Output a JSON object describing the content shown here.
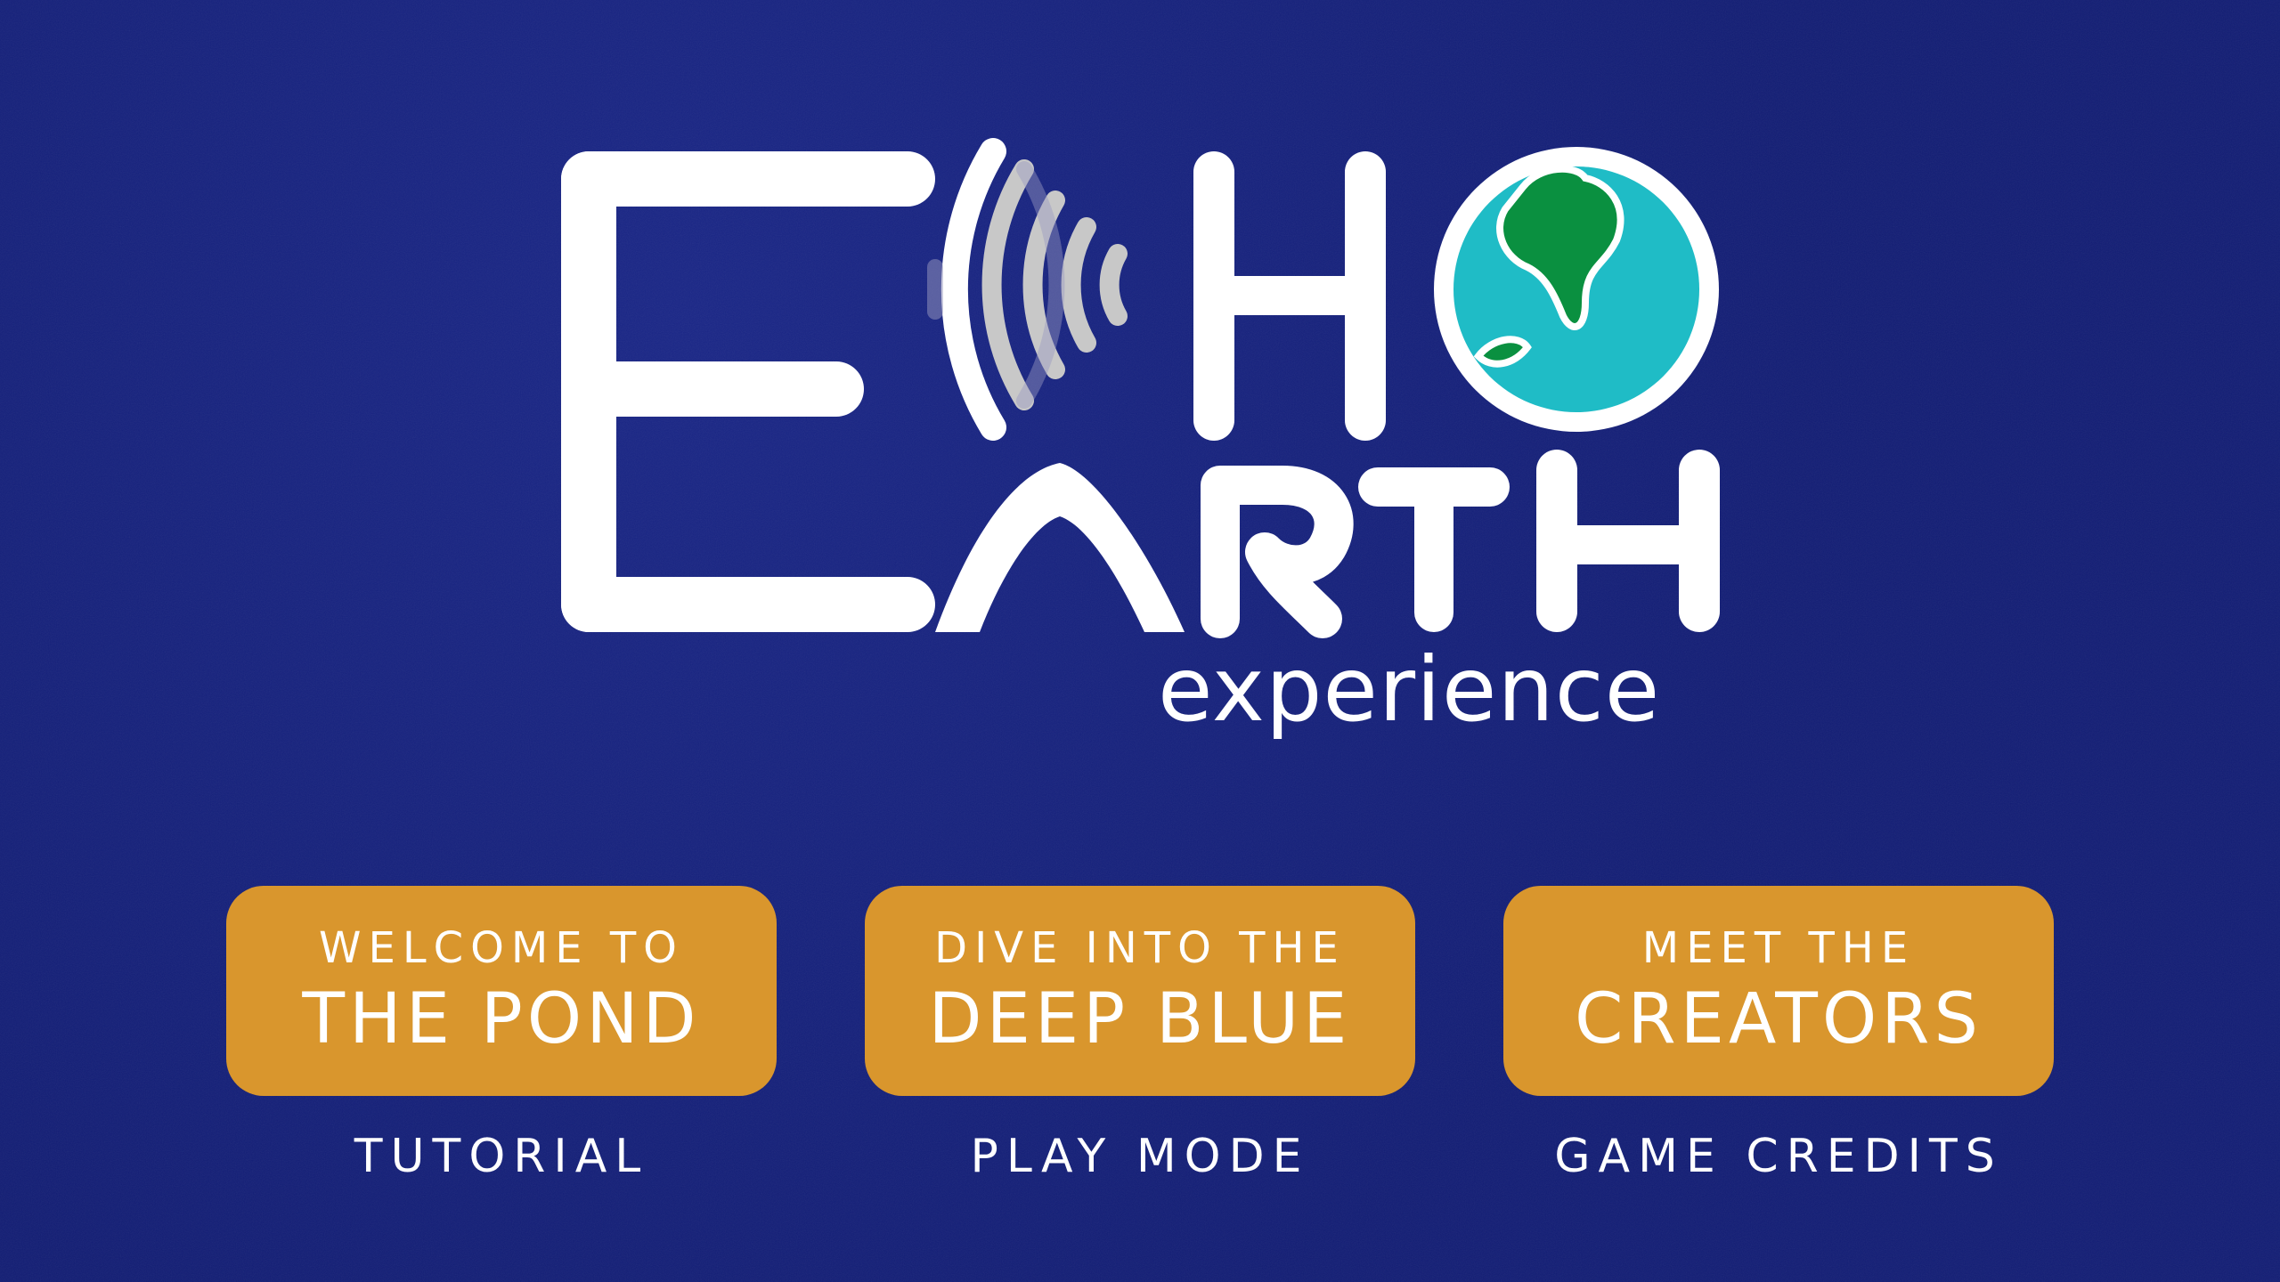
{
  "colors": {
    "background": "#121d74",
    "button": "#d9962d",
    "text": "#ffffff",
    "globe_ocean": "#1fbcc6",
    "globe_land": "#0a9040",
    "sound_waves": "#c8c8c8"
  },
  "logo": {
    "title_row1": "E HO",
    "title_row2": "ARTH",
    "subtitle": "experience",
    "icons": [
      "sound-wave-icon",
      "earth-globe-icon"
    ]
  },
  "menu": {
    "items": [
      {
        "line1": "WELCOME TO",
        "line2": "THE POND",
        "caption": "TUTORIAL"
      },
      {
        "line1": "DIVE INTO THE",
        "line2": "DEEP BLUE",
        "caption": "PLAY MODE"
      },
      {
        "line1": "MEET THE",
        "line2": "CREATORS",
        "caption": "GAME CREDITS"
      }
    ]
  }
}
